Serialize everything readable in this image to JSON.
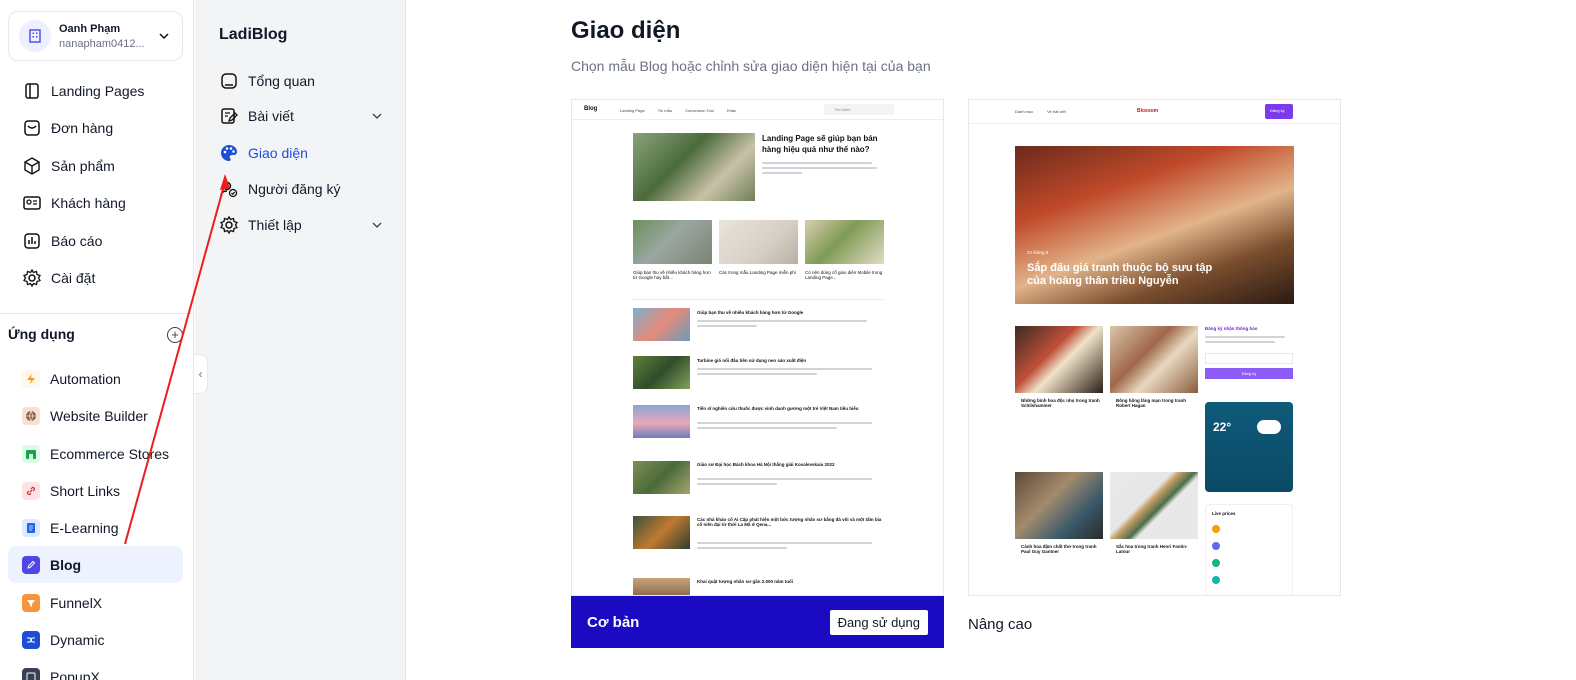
{
  "account": {
    "name": "Oanh Phạm",
    "email": "nanapham0412..."
  },
  "nav": [
    {
      "label": "Landing Pages",
      "icon": "landing-pages-icon"
    },
    {
      "label": "Đơn hàng",
      "icon": "orders-icon"
    },
    {
      "label": "Sản phẩm",
      "icon": "product-box-icon"
    },
    {
      "label": "Khách hàng",
      "icon": "customer-card-icon"
    },
    {
      "label": "Báo cáo",
      "icon": "report-chart-icon"
    },
    {
      "label": "Cài đặt",
      "icon": "gear-icon"
    }
  ],
  "apps": {
    "title": "Ứng dụng",
    "items": [
      {
        "label": "Automation",
        "color": "#fde68a",
        "fg": "#f59e0b"
      },
      {
        "label": "Website Builder",
        "color": "#f5e1d3",
        "fg": "#8b5a3c"
      },
      {
        "label": "Ecommerce Stores",
        "color": "#dcfce7",
        "fg": "#16a34a"
      },
      {
        "label": "Short Links",
        "color": "#fee2e2",
        "fg": "#dc2626"
      },
      {
        "label": "E-Learning",
        "color": "#dbeafe",
        "fg": "#2563eb"
      },
      {
        "label": "Blog",
        "color": "#4f46e5",
        "fg": "#ffffff",
        "active": true
      },
      {
        "label": "FunnelX",
        "color": "#fb923c",
        "fg": "#ffffff"
      },
      {
        "label": "Dynamic",
        "color": "#1d4ed8",
        "fg": "#ffffff"
      },
      {
        "label": "PopupX",
        "color": "#374151",
        "fg": "#ffffff"
      }
    ]
  },
  "subbar": {
    "title": "LadiBlog",
    "items": [
      {
        "label": "Tổng quan"
      },
      {
        "label": "Bài viết"
      },
      {
        "label": "Giao diện",
        "active": true
      },
      {
        "label": "Người đăng ký"
      },
      {
        "label": "Thiết lập"
      }
    ]
  },
  "main": {
    "title": "Giao diện",
    "subtitle": "Chọn mẫu Blog hoặc chỉnh sửa giao diện hiện tại của bạn",
    "themes": [
      {
        "name": "Cơ bản",
        "status": "Đang sử dụng"
      },
      {
        "name": "Nâng cao"
      }
    ]
  },
  "preview_a": {
    "logo": "Blog",
    "nav_links": [
      "Landing Page",
      "Tin mẫu",
      "Conversion Tool",
      "Khác"
    ],
    "search": "Tìm kiếm",
    "hero_title": "Landing Page sẽ giúp bạn bán hàng hiệu quả như thế nào?",
    "row3": [
      "Giúp bạn thu về nhiều khách hàng hơn từ Google hay bất...",
      "Các trong mẫu Landing Page miễn phí",
      "Có nên dùng cố giao diện Mobile trong Landing Page..."
    ],
    "list": [
      "Giúp bạn thu về nhiều khách hàng hơn từ Google",
      "Turbine gió nổi đầu tiên sử dụng neo sản xuất điện",
      "Tiến sĩ nghiên cứu thuốc được vinh danh gương một trẻ Việt Nam tiêu biểu",
      "Giáo sư Đại học Bách khoa Hà Nội thắng giải Kovalevskaia 2022",
      "Các nhà khảo cổ Ai Cập phát hiện một bức tượng nhân sư bằng đá vôi và một tấm bia cổ niên đại từ thời La Mã ở Qena...",
      "Khai quật tượng nhân sư gần 2.000 năm tuổi"
    ]
  },
  "preview_b": {
    "nav_links": [
      "Danh mục",
      "Về bài viết"
    ],
    "logo": "Blossom",
    "button": "Đăng ký",
    "hero_date": "24 tháng 8",
    "hero_title": "Sắp đấu giá tranh thuộc bộ sưu tập của hoàng thân triều Nguyễn",
    "tiles": [
      "Những bình hoa độc nhọ trong tranh Schilshammer",
      "Bông hồng lãng mạn trong tranh Robert Hagan",
      "Cảnh hoa đậm chất thơ trong tranh Paul Guy Gantner",
      "Sắc hoa trong tranh Henri Fantin-Latour"
    ],
    "newsletter_title": "Đăng ký nhận thông báo",
    "newsletter_btn": "Đăng ký",
    "weather_temp": "22°",
    "live_prices": "Live prices"
  }
}
